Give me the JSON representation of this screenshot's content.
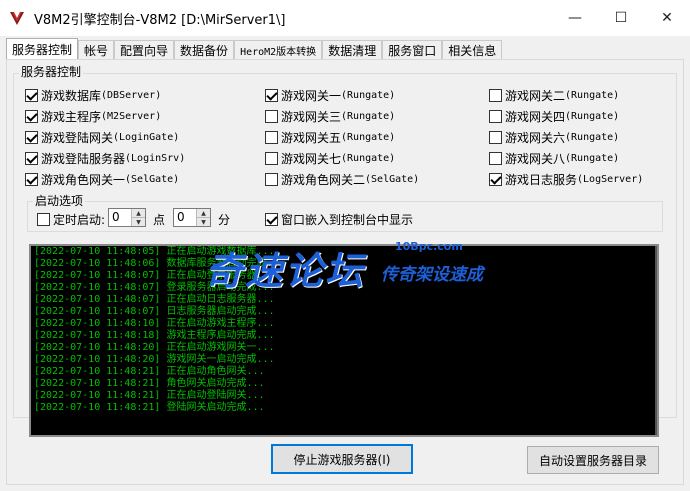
{
  "window": {
    "title": "V8M2引擎控制台-V8M2 [D:\\MirServer1\\]",
    "minimize": "—",
    "maximize": "☐",
    "close": "✕"
  },
  "tabs": [
    {
      "label": "服务器控制"
    },
    {
      "label": "帐号"
    },
    {
      "label": "配置向导"
    },
    {
      "label": "数据备份"
    },
    {
      "label": "HeroM2版本转换"
    },
    {
      "label": "数据清理"
    },
    {
      "label": "服务窗口"
    },
    {
      "label": "相关信息"
    }
  ],
  "server_group": {
    "legend": "服务器控制",
    "checkboxes": [
      {
        "cn": "游戏数据库",
        "en": "(DBServer)",
        "checked": true
      },
      {
        "cn": "游戏主程序",
        "en": "(M2Server)",
        "checked": true
      },
      {
        "cn": "游戏登陆网关",
        "en": "(LoginGate)",
        "checked": true
      },
      {
        "cn": "游戏登陆服务器",
        "en": "(LoginSrv)",
        "checked": true
      },
      {
        "cn": "游戏角色网关一",
        "en": "(SelGate)",
        "checked": true
      },
      {
        "cn": "游戏网关一",
        "en": "(Rungate)",
        "checked": true
      },
      {
        "cn": "游戏网关三",
        "en": "(Rungate)",
        "checked": false
      },
      {
        "cn": "游戏网关五",
        "en": "(Rungate)",
        "checked": false
      },
      {
        "cn": "游戏网关七",
        "en": "(Rungate)",
        "checked": false
      },
      {
        "cn": "游戏角色网关二",
        "en": "(SelGate)",
        "checked": false
      },
      {
        "cn": "游戏网关二",
        "en": "(Rungate)",
        "checked": false
      },
      {
        "cn": "游戏网关四",
        "en": "(Rungate)",
        "checked": false
      },
      {
        "cn": "游戏网关六",
        "en": "(Rungate)",
        "checked": false
      },
      {
        "cn": "游戏网关八",
        "en": "(Rungate)",
        "checked": false
      },
      {
        "cn": "游戏日志服务",
        "en": "(LogServer)",
        "checked": true
      }
    ]
  },
  "startup_group": {
    "legend": "启动选项",
    "timed_start_label": "定时启动:",
    "timed_start_checked": false,
    "hour_value": "0",
    "hour_unit": "点",
    "minute_value": "0",
    "minute_unit": "分",
    "embed_label": "窗口嵌入到控制台中显示",
    "embed_checked": true
  },
  "log": [
    "[2022-07-10 11:48:05] 正在启动游戏数据库...",
    "[2022-07-10 11:48:06] 数据库服务器启动完成...",
    "[2022-07-10 11:48:07] 正在启动登录服务器...",
    "[2022-07-10 11:48:07] 登录服务器启动完成...",
    "[2022-07-10 11:48:07] 正在启动日志服务器...",
    "[2022-07-10 11:48:07] 日志服务器启动完成...",
    "[2022-07-10 11:48:10] 正在启动游戏主程序...",
    "[2022-07-10 11:48:18] 游戏主程序启动完成...",
    "[2022-07-10 11:48:20] 正在启动游戏网关一...",
    "[2022-07-10 11:48:20] 游戏网关一启动完成...",
    "[2022-07-10 11:48:21] 正在启动角色网关...",
    "[2022-07-10 11:48:21] 角色网关启动完成...",
    "[2022-07-10 11:48:21] 正在启动登陆网关...",
    "[2022-07-10 11:48:21] 登陆网关启动完成..."
  ],
  "watermark": {
    "main": "奇速论坛",
    "url": "10Bpc.com",
    "sub": "传奇架设速成"
  },
  "buttons": {
    "stop": "停止游戏服务器(I)",
    "auto_dir": "自动设置服务器目录"
  },
  "colors": {
    "log_text": "#00c000",
    "console_bg": "#000000",
    "watermark": "#1d5fd6",
    "focus_border": "#0078d7"
  }
}
